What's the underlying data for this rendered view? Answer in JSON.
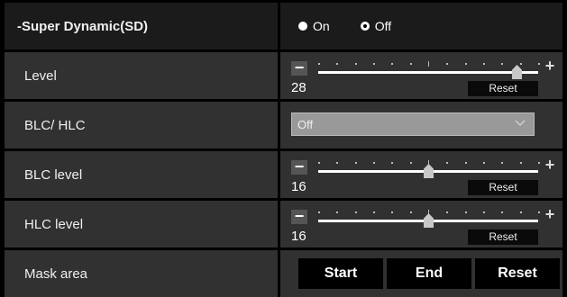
{
  "super_dynamic": {
    "label": "-Super Dynamic(SD)",
    "options": [
      "On",
      "Off"
    ],
    "selected": "Off"
  },
  "level": {
    "label": "Level",
    "value": "28",
    "reset_label": "Reset",
    "minus_label": "−",
    "plus_label": "+"
  },
  "blc_hlc": {
    "label": "BLC/ HLC",
    "selected": "Off"
  },
  "blc_level": {
    "label": "BLC level",
    "value": "16",
    "reset_label": "Reset",
    "minus_label": "−",
    "plus_label": "+"
  },
  "hlc_level": {
    "label": "HLC level",
    "value": "16",
    "reset_label": "Reset",
    "minus_label": "−",
    "plus_label": "+"
  },
  "mask_area": {
    "label": "Mask area",
    "start_label": "Start",
    "end_label": "End",
    "reset_label": "Reset"
  },
  "colors": {
    "row_bg": "#313131",
    "header_bg": "#1b1b1b",
    "button_bg": "#000000"
  },
  "sliders": {
    "level_fraction": 0.9,
    "blc_fraction": 0.5,
    "hlc_fraction": 0.5
  }
}
